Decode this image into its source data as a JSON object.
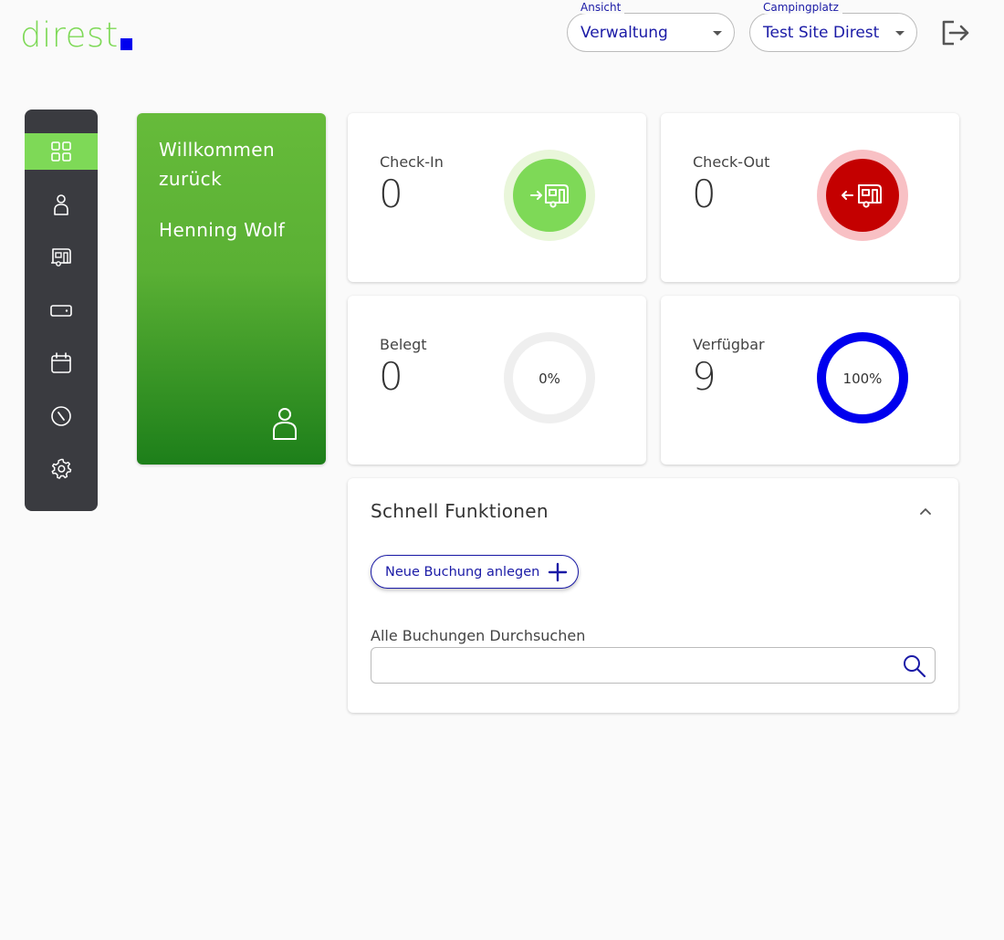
{
  "header": {
    "logo_text": "direst",
    "colors": {
      "brand_green": "#7ed957",
      "brand_blue": "#0000ee"
    },
    "view_select": {
      "label": "Ansicht",
      "value": "Verwaltung"
    },
    "site_select": {
      "label": "Campingplatz",
      "value": "Test Site Direst"
    },
    "logout_icon": "logout-icon"
  },
  "sidebar": {
    "items": [
      {
        "icon": "dashboard-grid-icon",
        "active": true
      },
      {
        "icon": "person-icon",
        "active": false
      },
      {
        "icon": "caravan-icon",
        "active": false
      },
      {
        "icon": "wallet-icon",
        "active": false
      },
      {
        "icon": "calendar-icon",
        "active": false
      },
      {
        "icon": "compass-icon",
        "active": false
      },
      {
        "icon": "gear-icon",
        "active": false
      }
    ]
  },
  "welcome": {
    "greeting": "Willkommen zurück",
    "name": "Henning Wolf"
  },
  "stats": {
    "checkin": {
      "label": "Check-In",
      "value": "0",
      "icon": "caravan-arrow-in-icon",
      "color": "#7ed957"
    },
    "checkout": {
      "label": "Check-Out",
      "value": "0",
      "icon": "caravan-arrow-out-icon",
      "color": "#c40000"
    },
    "belegt": {
      "label": "Belegt",
      "value": "0",
      "percent_text": "0%",
      "percent": 0
    },
    "verfuegbar": {
      "label": "Verfügbar",
      "value": "9",
      "percent_text": "100%",
      "percent": 100,
      "color": "#0000ee"
    }
  },
  "quick": {
    "title": "Schnell Funktionen",
    "new_booking_label": "Neue Buchung anlegen",
    "search_label": "Alle Buchungen Durchsuchen",
    "search_value": ""
  }
}
